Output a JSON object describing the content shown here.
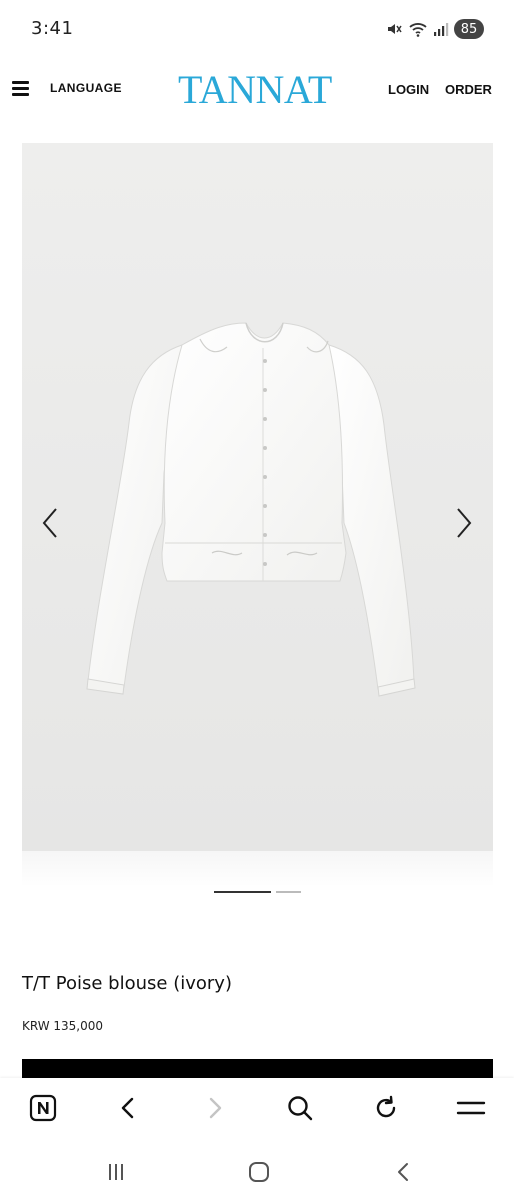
{
  "status_bar": {
    "time": "3:41",
    "battery": "85",
    "icons": [
      "mute-icon",
      "wifi-icon",
      "signal-icon",
      "battery-icon"
    ]
  },
  "header": {
    "menu_icon": "hamburger-menu-icon",
    "language_label": "LANGUAGE",
    "logo_text": "TANNAT",
    "login_label": "LOGIN",
    "order_label": "ORDER",
    "logo_color": "#2aa8d8"
  },
  "gallery": {
    "prev_icon": "chevron-left-icon",
    "next_icon": "chevron-right-icon",
    "image_subject": "white blouse",
    "current_slide": 1,
    "total_slides": 2
  },
  "product": {
    "name": "T/T Poise blouse (ivory)",
    "price": "KRW 135,000"
  },
  "browser_toolbar": {
    "icons": [
      "naver-home-icon",
      "back-arrow-icon",
      "forward-arrow-icon",
      "search-icon",
      "refresh-icon",
      "menu-icon"
    ]
  },
  "system_nav": {
    "icons": [
      "recent-apps-icon",
      "home-icon",
      "back-icon"
    ]
  }
}
